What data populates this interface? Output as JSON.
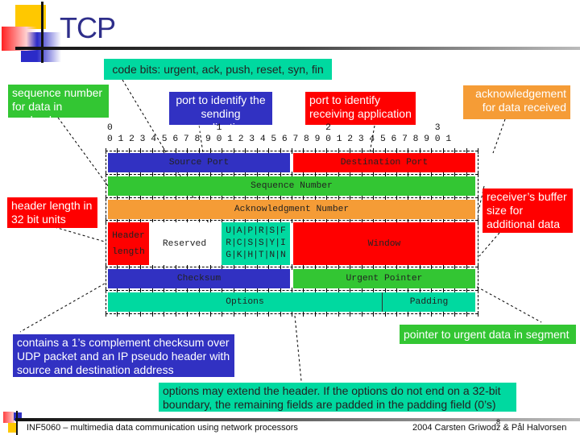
{
  "slide": {
    "title": "TCP"
  },
  "callouts": {
    "code_bits": "code bits: urgent, ack, push, reset, syn, fin",
    "sequence_number": [
      "sequence number",
      "for data in payload"
    ],
    "source_port": [
      "port to identify the",
      "sending application"
    ],
    "destination_port": [
      "port to identify",
      "receiving application"
    ],
    "acknowledgement": [
      "acknowledgement",
      "for data received"
    ],
    "header_length": [
      "header length in",
      "32 bit units"
    ],
    "window": [
      "receiver’s buffer",
      "size for",
      "additional data"
    ],
    "checksum": [
      "contains a 1’s complement checksum over",
      "UDP packet and an IP pseudo header with",
      "source and destination address"
    ],
    "urgent_pointer": "pointer to urgent data in segment",
    "options": [
      "options may extend the header. If the options do not end on a 32-bit",
      "boundary, the remaining fields are padded in the padding field (0’s)"
    ]
  },
  "bit_ruler": {
    "tens_row": "0                   1                   2                   3",
    "units_row": "0 1 2 3 4 5 6 7 8 9 0 1 2 3 4 5 6 7 8 9 0 1 2 3 4 5 6 7 8 9 0 1"
  },
  "header_fields": {
    "source_port": "Source Port",
    "destination_port": "Destination Port",
    "sequence_number": "Sequence Number",
    "acknowledgment_number": "Acknowledgment Number",
    "header_length": [
      "Header",
      "length"
    ],
    "reserved": "Reserved",
    "flags_rows": [
      "U|A|P|R|S|F",
      "R|C|S|S|Y|I",
      "G|K|H|T|N|N"
    ],
    "window": "Window",
    "checksum": "Checksum",
    "urgent_pointer": "Urgent Pointer",
    "options": "Options",
    "padding": "Padding"
  },
  "colors": {
    "teal": "#00d9a0",
    "green": "#33c633",
    "blue": "#3131c2",
    "red": "#ff0000",
    "orange": "#f59c36",
    "title": "#2e2e8a"
  },
  "footer": {
    "course": "INF5060 – multimedia data communication using network processors",
    "credit": "2004  Carsten Griwodz & Pål Halvorsen",
    "page_number": "8"
  }
}
